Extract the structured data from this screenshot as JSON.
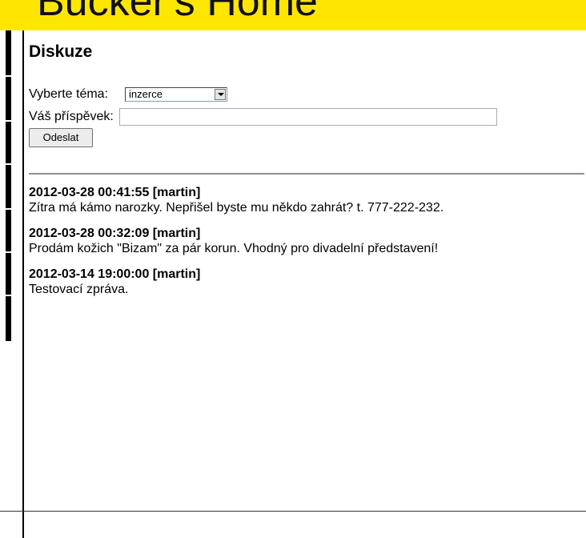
{
  "header": {
    "title": "Bucker's Home"
  },
  "page": {
    "title": "Diskuze"
  },
  "form": {
    "topic_label": "Vyberte téma:",
    "topic_selected": "inzerce",
    "post_label": "Váš příspěvek:",
    "post_value": "",
    "submit_label": "Odeslat"
  },
  "messages": [
    {
      "header": "2012-03-28 00:41:55 [martin]",
      "body": "Zítra má kámo narozky. Nepřišel byste mu někdo zahrát? t. 777-222-232."
    },
    {
      "header": "2012-03-28 00:32:09 [martin]",
      "body": "Prodám kožich \"Bizam\" za pár korun. Vhodný pro divadelní představení!"
    },
    {
      "header": "2012-03-14 19:00:00 [martin]",
      "body": "Testovací zpráva."
    }
  ],
  "colors": {
    "banner": "#ffe600",
    "sidebar": "#000000"
  }
}
